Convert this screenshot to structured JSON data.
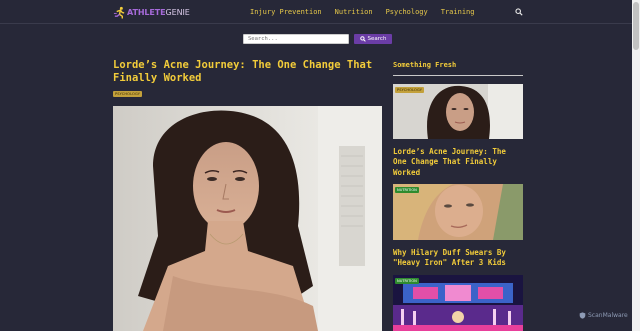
{
  "header": {
    "logo_part1": "ATHLETE",
    "logo_part2": "GENIE",
    "nav": [
      "Injury Prevention",
      "Nutrition",
      "Psychology",
      "Training"
    ],
    "search_icon": "search-icon"
  },
  "search": {
    "placeholder": "Search...",
    "button_label": "Search",
    "button_icon": "search-icon"
  },
  "article": {
    "title": "Lorde’s Acne Journey: The One Change That Finally Worked",
    "category": "PSYCHOLOGY"
  },
  "sidebar": {
    "heading": "Something Fresh",
    "cards": [
      {
        "category": "PSYCHOLOGY",
        "title": "Lorde’s Acne Journey: The One Change That Finally Worked"
      },
      {
        "category": "NUTRITION",
        "title": "Why Hilary Duff Swears By \"Heavy Iron\" After 3 Kids"
      },
      {
        "category": "NUTRITION",
        "title": ""
      }
    ]
  },
  "watermark": "ScanMalware",
  "colors": {
    "background": "#272838",
    "accent_yellow": "#f2cc3a",
    "purple": "#6b3da6",
    "badge_green": "#2e8b2e",
    "badge_gold": "#c3a13b"
  }
}
